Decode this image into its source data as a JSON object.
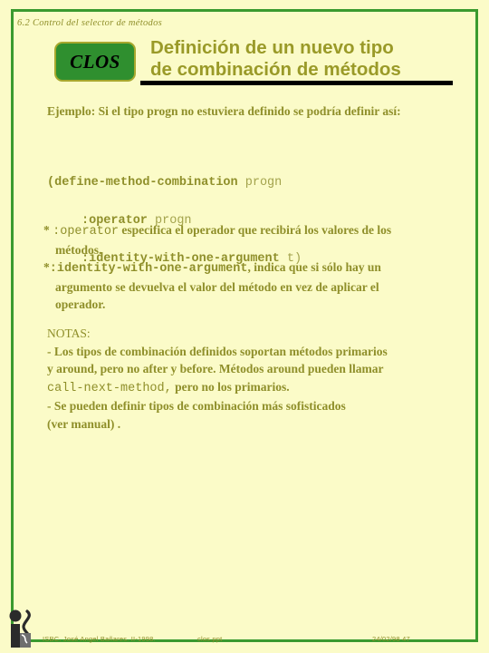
{
  "slide": {
    "section_label": "6.2 Control del selector de métodos",
    "badge_text": "CLOS",
    "title_line1": "Definición de un nuevo tipo",
    "title_line2": "de combinación de métodos",
    "colors": {
      "background": "#fbfbc8",
      "frame": "#3a9a2f",
      "badge_fill": "#2f8f2f",
      "badge_border": "#a8a82e",
      "text": "#8f8f2a",
      "title": "#9a9a28",
      "rule": "#000000"
    }
  },
  "content": {
    "intro": "Ejemplo:  Si el tipo progn no estuviera definido se podría definir así:",
    "code": {
      "line1_strong": "(define-method-combination",
      "line1_lite": " progn",
      "line2_strong": ":operator",
      "line2_lite": " progn",
      "line3_strong": ":identity-with-one-argument",
      "line3_lite": " t)"
    },
    "bullets": [
      {
        "marker": "*",
        "code": ":operator",
        "text": "  especifica el operador que recibirá los valores de los",
        "cont": "métodos."
      },
      {
        "marker": "*",
        "code": ":identity-with-one-argument",
        "text": ", indica que si sólo hay un",
        "cont": "argumento se devuelva el valor del método en vez de aplicar el",
        "cont2": "operador."
      }
    ],
    "notes": {
      "heading": "NOTAS:",
      "line1": "- Los tipos de combinación definidos soportan métodos primarios",
      "line2": " y around, pero   no after y before. Métodos around pueden llamar",
      "line3_code": "call-next-method,",
      "line3_rest": " pero no los primarios.",
      "line4": "- Se pueden definir tipos de  combinación más sofisticados",
      "line5": " (ver manual) ."
    }
  },
  "footer": {
    "author": "ISBC. José Angel Bañares. II-1998.",
    "file": "clos.ppt",
    "date_page": "24/02/98  47",
    "logo_name": "isbc-person-logo"
  }
}
